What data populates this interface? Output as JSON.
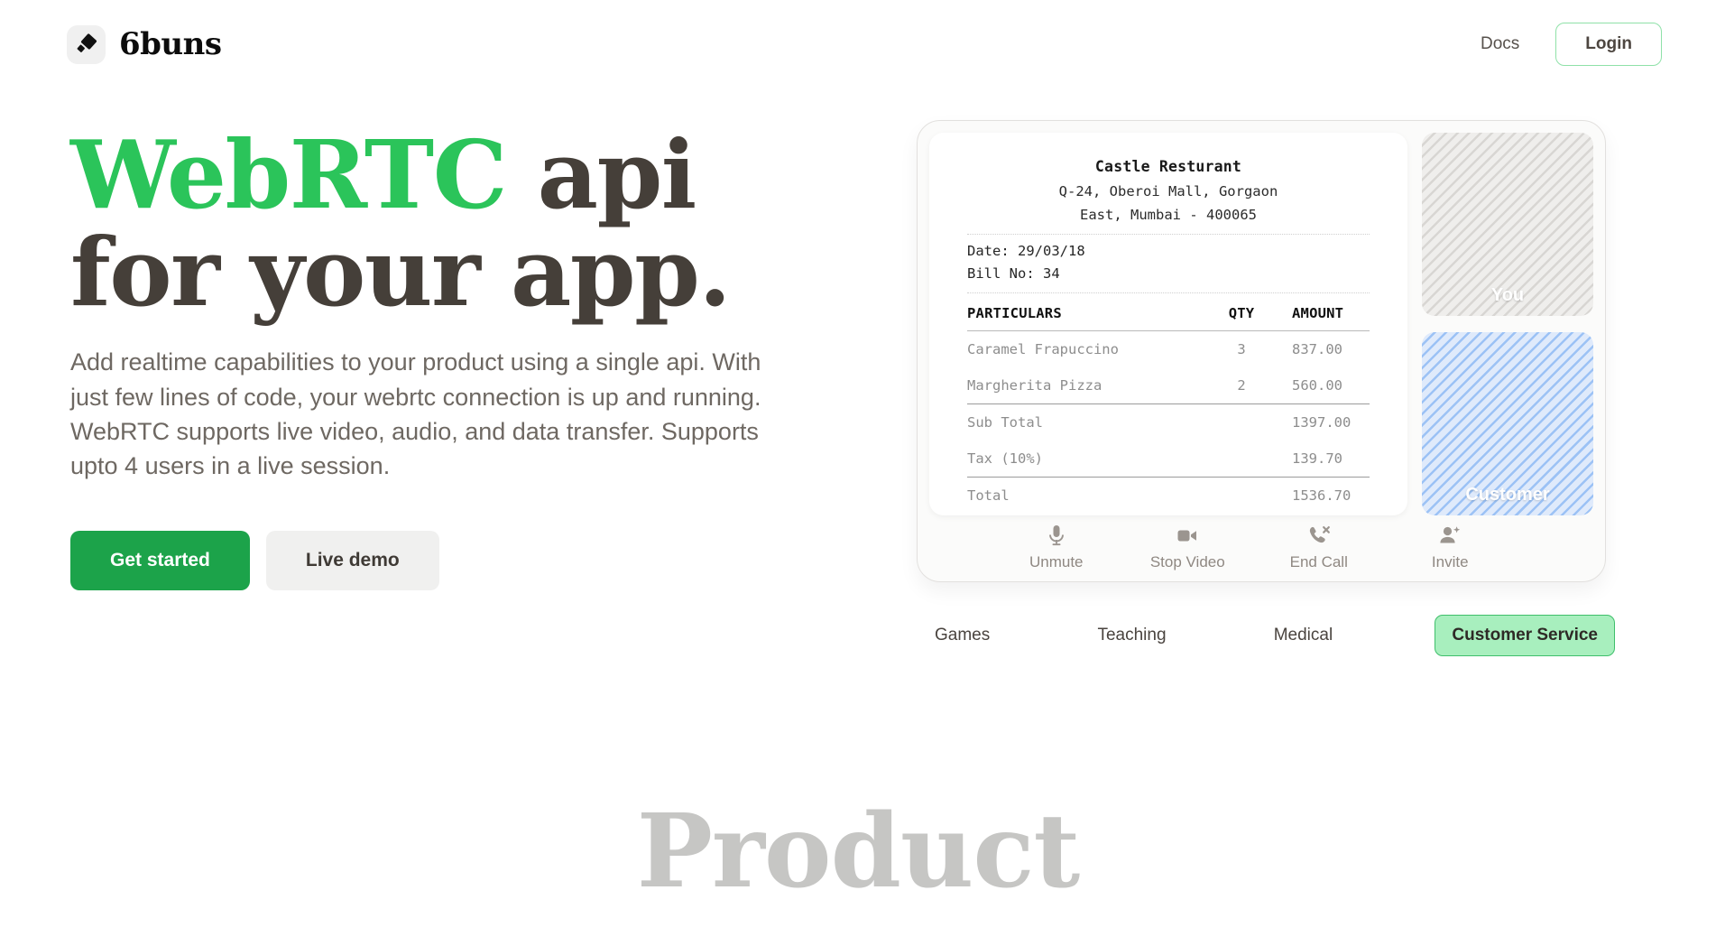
{
  "nav": {
    "brand_name": "6buns",
    "logo_icon": "diamond-logo-icon",
    "docs_label": "Docs",
    "login_label": "Login"
  },
  "hero": {
    "headline_green": "WebRTC",
    "headline_rest_line1": " api",
    "headline_line2": "for your app.",
    "subtext": "Add realtime capabilities to your product using a single api. With just few lines of code, your webrtc connection is up and running. WebRTC supports live video, audio, and data transfer. Supports upto 4 users in a live session.",
    "primary_cta": "Get started",
    "secondary_cta": "Live demo"
  },
  "demo": {
    "receipt": {
      "title": "Castle Resturant",
      "address_line1": "Q-24, Oberoi Mall, Gorgaon",
      "address_line2": "East, Mumbai - 400065",
      "date_label": "Date: 29/03/18",
      "bill_label": "Bill No: 34",
      "columns": {
        "particulars": "PARTICULARS",
        "qty": "QTY",
        "amount": "AMOUNT"
      },
      "items": [
        {
          "name": "Caramel Frapuccino",
          "qty": "3",
          "amount": "837.00"
        },
        {
          "name": "Margherita Pizza",
          "qty": "2",
          "amount": "560.00"
        }
      ],
      "sub_total_label": "Sub Total",
      "sub_total_value": "1397.00",
      "tax_label": "Tax (10%)",
      "tax_value": "139.70",
      "total_label": "Total",
      "total_value": "1536.70"
    },
    "video_tiles": [
      {
        "label": "You",
        "icon": "video-tile-self-icon"
      },
      {
        "label": "Customer",
        "icon": "video-tile-remote-icon"
      }
    ],
    "controls": [
      {
        "label": "Unmute",
        "icon": "microphone-icon"
      },
      {
        "label": "Stop Video",
        "icon": "video-camera-icon"
      },
      {
        "label": "End Call",
        "icon": "phone-hangup-icon"
      },
      {
        "label": "Invite",
        "icon": "person-add-icon"
      }
    ]
  },
  "tabs": [
    {
      "label": "Games",
      "active": false
    },
    {
      "label": "Teaching",
      "active": false
    },
    {
      "label": "Medical",
      "active": false
    },
    {
      "label": "Customer Service",
      "active": true
    }
  ],
  "section": {
    "product_title": "Product"
  },
  "colors": {
    "headline_green": "#2bc45a",
    "button_green": "#1ca34a",
    "accent_border_green": "#8fe1a8",
    "active_tab_fill": "#a8efbe",
    "dark_text": "#453f39",
    "muted_text": "#6e6862",
    "product_gray": "#c6c6c4"
  }
}
